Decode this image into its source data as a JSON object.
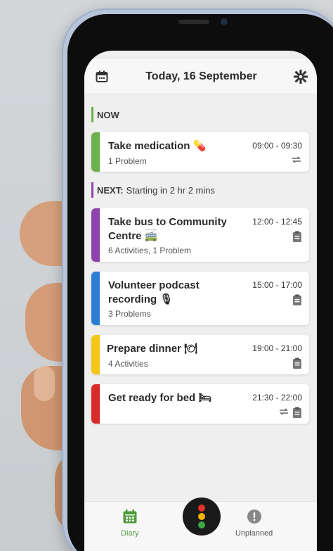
{
  "header": {
    "title": "Today, 16 September",
    "calendar_icon": "calendar-icon",
    "settings_icon": "gear-icon"
  },
  "now": {
    "label": "NOW",
    "color": "#6ab04c"
  },
  "next": {
    "label": "NEXT:",
    "text": "Starting in 2 hr 2 mins",
    "color": "#8e44ad"
  },
  "cards": [
    {
      "title": "Take medication 💊",
      "subtitle": "1 Problem",
      "time": "09:00 - 09:30",
      "color": "#6ab04c",
      "icons": [
        "repeat-icon"
      ]
    },
    {
      "title": "Take bus to Community Centre 🚎",
      "subtitle": "6 Activities, 1 Problem",
      "time": "12:00 - 12:45",
      "color": "#8e44ad",
      "icons": [
        "clipboard-icon"
      ]
    },
    {
      "title": "Volunteer podcast recording 🎙",
      "subtitle": "3 Problems",
      "time": "15:00 - 17:00",
      "color": "#2d7fd6",
      "icons": [
        "clipboard-icon"
      ]
    },
    {
      "title": "Prepare dinner 🍽",
      "subtitle": "4 Activities",
      "time": "19:00 - 21:00",
      "color": "#f5c518",
      "icons": [
        "clipboard-icon"
      ]
    },
    {
      "title": "Get ready for bed 🛏",
      "subtitle": "",
      "time": "21:30 - 22:00",
      "color": "#d92a2a",
      "icons": [
        "repeat-icon",
        "clipboard-icon"
      ]
    }
  ],
  "nav": {
    "diary_label": "Diary",
    "unplanned_label": "Unplanned",
    "diary_color": "#4f9a3a"
  }
}
